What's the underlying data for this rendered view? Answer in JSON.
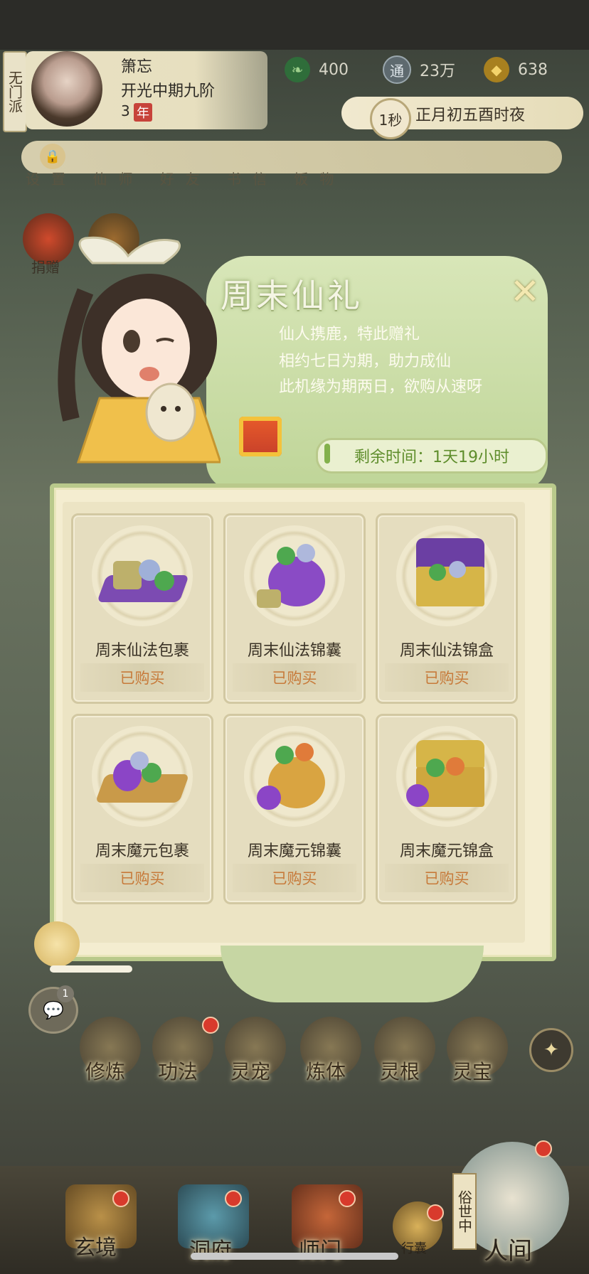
{
  "header": {
    "sect": "无门派",
    "player_name": "箫忘",
    "player_rank": "开光中期九阶",
    "player_age": "3",
    "player_age_unit": "年",
    "resources": [
      {
        "icon": "jade-leaf-icon",
        "value": "400"
      },
      {
        "icon": "coin-icon",
        "coin_char": "通",
        "value": "23万"
      },
      {
        "icon": "gold-ingot-icon",
        "value": "638"
      }
    ],
    "time_speed": "1秒",
    "game_time": "正月初五酉时夜",
    "faded_nav": "设置 仙师 好友 书信 饭物 关注礼",
    "donate_label": "捐赠"
  },
  "modal": {
    "title": "周末仙礼",
    "desc_lines": [
      "仙人携鹿，特此赠礼",
      "相约七日为期，助力成仙",
      "此机缘为期两日，欲购从速呀"
    ],
    "timer": "剩余时间：1天19小时",
    "items": [
      {
        "name": "周末仙法包裹",
        "status": "已购买"
      },
      {
        "name": "周末仙法锦囊",
        "status": "已购买"
      },
      {
        "name": "周末仙法锦盒",
        "status": "已购买"
      },
      {
        "name": "周末魔元包裹",
        "status": "已购买"
      },
      {
        "name": "周末魔元锦囊",
        "status": "已购买"
      },
      {
        "name": "周末魔元锦盒",
        "status": "已购买"
      }
    ]
  },
  "chat": {
    "badge": "1"
  },
  "skills": [
    "修炼",
    "功法",
    "灵宠",
    "炼体",
    "灵根",
    "灵宝"
  ],
  "bottom_nav": {
    "tabs": [
      "玄境",
      "洞府",
      "师门"
    ],
    "bag": "行囊",
    "world": "人间",
    "world_side": "俗世中"
  },
  "colors": {
    "accent_green": "#b9c98b",
    "bought_text": "#c77a3a",
    "timer_text": "#5e8d2b",
    "badge_red": "#d83a2c"
  }
}
